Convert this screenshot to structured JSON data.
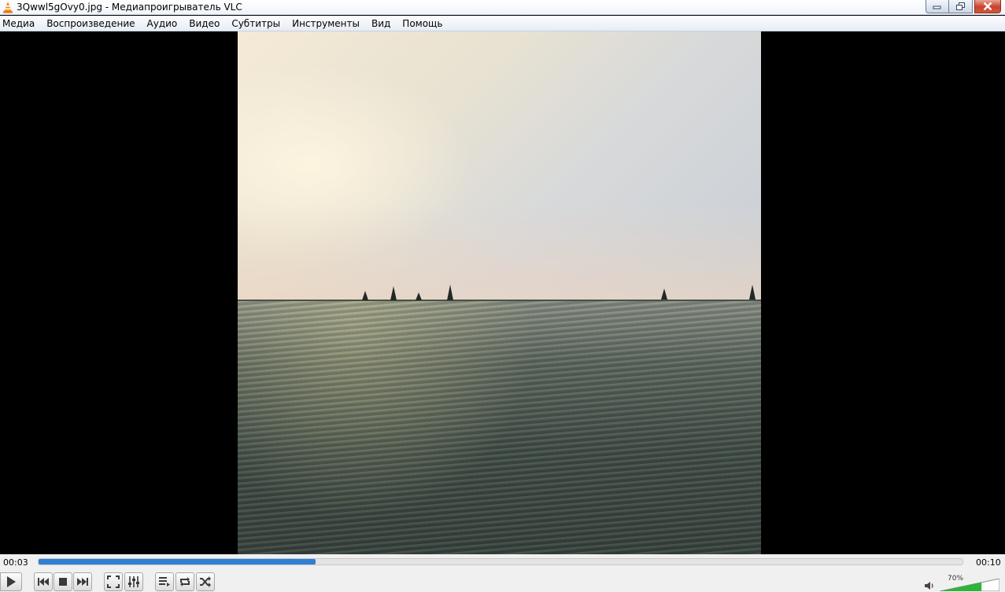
{
  "window": {
    "title": "3Qwwl5gOvy0.jpg - Медиапроигрыватель VLC",
    "buttons": [
      "minimize-icon",
      "restore-icon",
      "close-icon"
    ]
  },
  "menu": {
    "items": [
      {
        "label": "Медиа"
      },
      {
        "label": "Воспроизведение"
      },
      {
        "label": "Аудио"
      },
      {
        "label": "Видео"
      },
      {
        "label": "Субтитры"
      },
      {
        "label": "Инструменты"
      },
      {
        "label": "Вид"
      },
      {
        "label": "Помощь"
      }
    ]
  },
  "player": {
    "elapsed": "00:03",
    "total": "00:10",
    "progress_fraction": 0.3,
    "volume_label": "70%",
    "volume_fraction": 0.7
  },
  "controls": {
    "icons": [
      "play-icon",
      "previous-icon",
      "stop-icon",
      "next-icon",
      "fullscreen-icon",
      "extended-settings-icon",
      "playlist-icon",
      "loop-icon",
      "shuffle-icon",
      "volume-icon"
    ]
  },
  "colors": {
    "progress": "#2f7fd3",
    "volume_fill": "#2fb33a",
    "close_button": "#c8432b"
  }
}
